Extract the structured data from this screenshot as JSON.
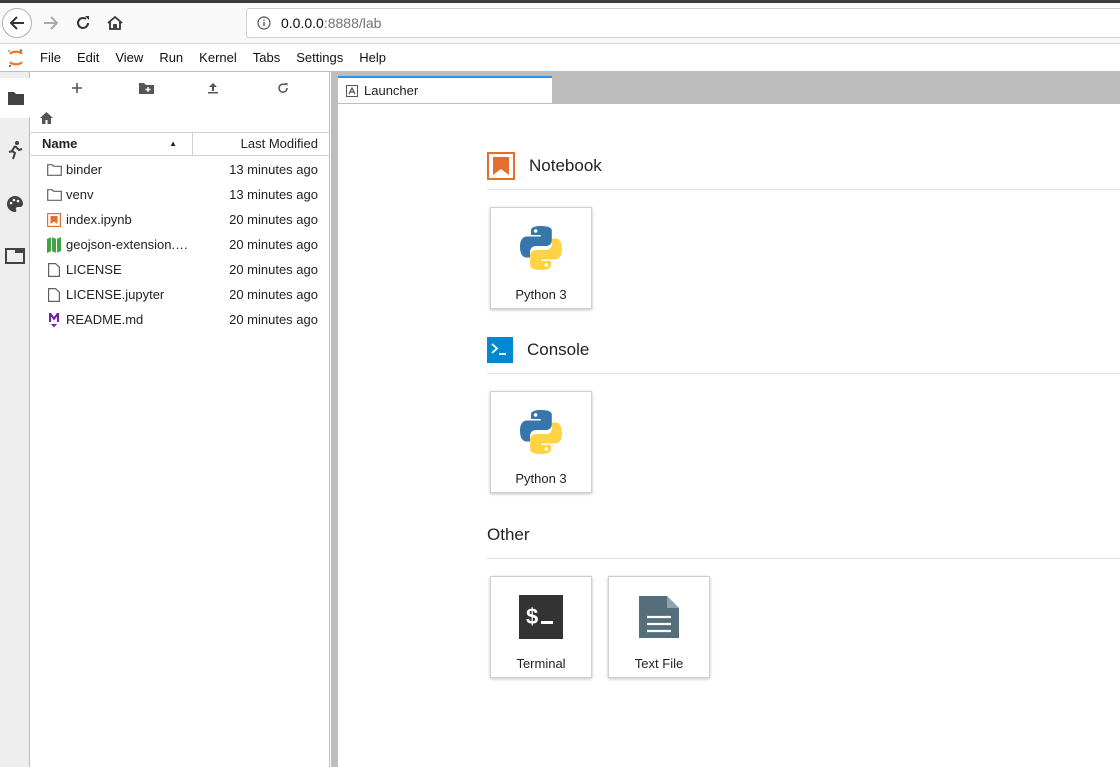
{
  "browser": {
    "url_host": "0.0.0.0",
    "url_rest": ":8888/lab",
    "icons": [
      "back-icon",
      "forward-icon",
      "reload-icon",
      "home-icon",
      "info-icon"
    ]
  },
  "menubar": {
    "items": [
      "File",
      "Edit",
      "View",
      "Run",
      "Kernel",
      "Tabs",
      "Settings",
      "Help"
    ]
  },
  "filebrowser": {
    "columns": {
      "name": "Name",
      "modified": "Last Modified"
    },
    "files": [
      {
        "name": "binder",
        "modified": "13 minutes ago",
        "icon": "folder-icon"
      },
      {
        "name": "venv",
        "modified": "13 minutes ago",
        "icon": "folder-icon"
      },
      {
        "name": "index.ipynb",
        "modified": "20 minutes ago",
        "icon": "notebook-icon"
      },
      {
        "name": "geojson-extension.…",
        "modified": "20 minutes ago",
        "icon": "map-icon"
      },
      {
        "name": "LICENSE",
        "modified": "20 minutes ago",
        "icon": "file-icon"
      },
      {
        "name": "LICENSE.jupyter",
        "modified": "20 minutes ago",
        "icon": "file-icon"
      },
      {
        "name": "README.md",
        "modified": "20 minutes ago",
        "icon": "markdown-icon"
      }
    ]
  },
  "tab": {
    "label": "Launcher"
  },
  "launcher": {
    "notebook": {
      "title": "Notebook",
      "cards": [
        "Python 3"
      ]
    },
    "console": {
      "title": "Console",
      "cards": [
        "Python 3"
      ]
    },
    "other": {
      "title": "Other",
      "cards": [
        "Terminal",
        "Text File"
      ]
    }
  },
  "colors": {
    "accent": "#2196f3",
    "notebook_orange": "#e46e2e",
    "console_blue": "#0288d1",
    "map_green": "#43a047",
    "markdown_purple": "#7b1fa2"
  }
}
